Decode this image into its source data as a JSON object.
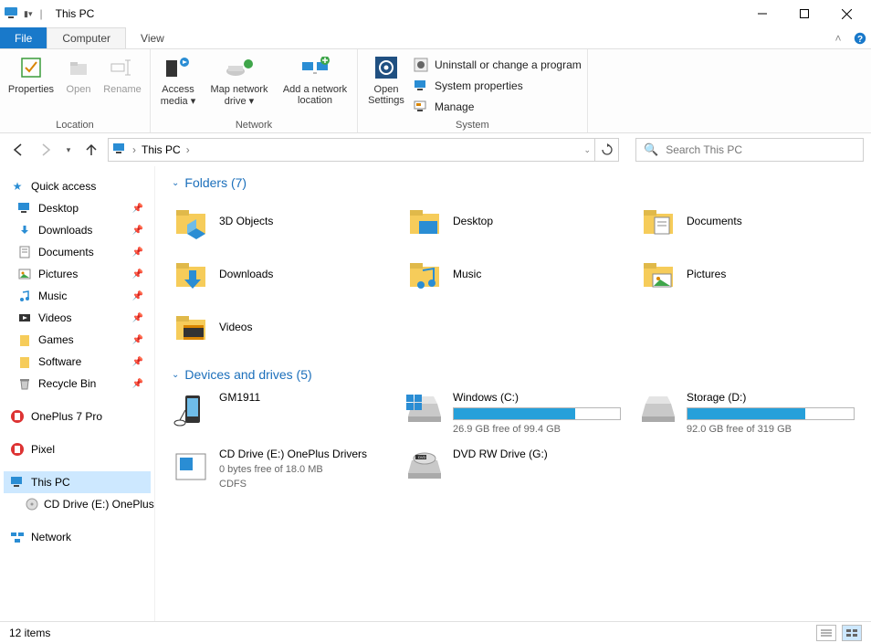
{
  "title": "This PC",
  "tabs": {
    "file": "File",
    "computer": "Computer",
    "view": "View"
  },
  "ribbon": {
    "location": {
      "label": "Location",
      "properties": "Properties",
      "open": "Open",
      "rename": "Rename"
    },
    "network": {
      "label": "Network",
      "access_media": "Access media ▾",
      "map_drive": "Map network drive ▾",
      "add_location": "Add a network location"
    },
    "open_settings": "Open Settings",
    "system": {
      "label": "System",
      "uninstall": "Uninstall or change a program",
      "props": "System properties",
      "manage": "Manage"
    }
  },
  "address": {
    "root": "This PC"
  },
  "search_placeholder": "Search This PC",
  "nav": {
    "quick_access": "Quick access",
    "items": [
      {
        "label": "Desktop",
        "pinned": true
      },
      {
        "label": "Downloads",
        "pinned": true
      },
      {
        "label": "Documents",
        "pinned": true
      },
      {
        "label": "Pictures",
        "pinned": true
      },
      {
        "label": "Music",
        "pinned": true
      },
      {
        "label": "Videos",
        "pinned": true
      },
      {
        "label": "Games",
        "pinned": true
      },
      {
        "label": "Software",
        "pinned": true
      },
      {
        "label": "Recycle Bin",
        "pinned": true
      }
    ],
    "oneplus": "OnePlus 7 Pro",
    "pixel": "Pixel",
    "thispc": "This PC",
    "cd": "CD Drive (E:) OnePlus",
    "network": "Network"
  },
  "sections": {
    "folders_header": "Folders (7)",
    "folders": [
      {
        "label": "3D Objects"
      },
      {
        "label": "Desktop"
      },
      {
        "label": "Documents"
      },
      {
        "label": "Downloads"
      },
      {
        "label": "Music"
      },
      {
        "label": "Pictures"
      },
      {
        "label": "Videos"
      }
    ],
    "drives_header": "Devices and drives (5)",
    "drives": [
      {
        "name": "GM1911",
        "type": "phone"
      },
      {
        "name": "Windows (C:)",
        "free": "26.9 GB free of 99.4 GB",
        "used_pct": 73,
        "type": "disk"
      },
      {
        "name": "Storage (D:)",
        "free": "92.0 GB free of 319 GB",
        "used_pct": 71,
        "type": "disk"
      },
      {
        "name": "CD Drive (E:) OnePlus Drivers",
        "free": "0 bytes free of 18.0 MB",
        "fs": "CDFS",
        "type": "cd"
      },
      {
        "name": "DVD RW Drive (G:)",
        "type": "dvd"
      }
    ]
  },
  "status": "12 items"
}
